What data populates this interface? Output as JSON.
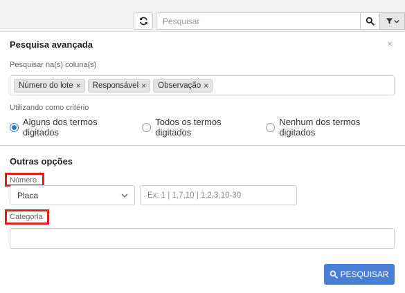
{
  "toolbar": {
    "search_placeholder": "Pesquisar",
    "refresh_icon": "refresh-icon",
    "search_icon": "search-icon",
    "filter_icon": "filter-icon"
  },
  "panel": {
    "title": "Pesquisa avançada",
    "close_label": "×",
    "columns_label": "Pesquisar na(s) coluna(s)",
    "tags": [
      {
        "label": "Número do lote",
        "remove": "×"
      },
      {
        "label": "Responsável",
        "remove": "×"
      },
      {
        "label": "Observação",
        "remove": "×"
      }
    ],
    "criteria_label": "Utilizando como critério",
    "criteria_options": [
      {
        "label": "Alguns dos termos digitados",
        "selected": true
      },
      {
        "label": "Todos os termos digitados",
        "selected": false
      },
      {
        "label": "Nenhum dos termos digitados",
        "selected": false
      }
    ]
  },
  "other_options": {
    "title": "Outras opções",
    "numero_label": "Número",
    "numero_select_value": "Placa",
    "numero_input_placeholder": "Ex: 1 | 1,7,10 | 1,2,3,10-30",
    "categoria_label": "Categoria",
    "categoria_value": ""
  },
  "submit_label": "PESQUISAR",
  "colors": {
    "accent": "#4a7fd6",
    "highlight": "#e01e1e",
    "radio_selected": "#2b79d6"
  }
}
